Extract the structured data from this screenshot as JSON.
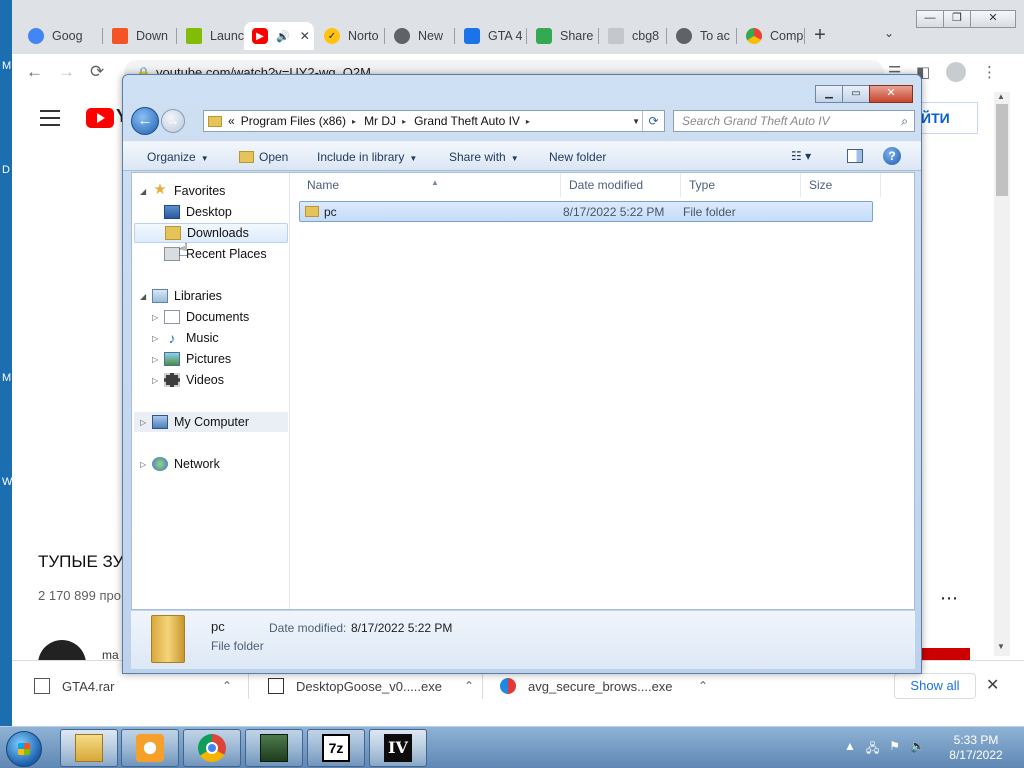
{
  "desktop_edge_letters": [
    {
      "text": "M",
      "top": 0
    },
    {
      "text": "D",
      "top": 0
    },
    {
      "text": "M",
      "top": 0
    },
    {
      "text": "W",
      "top": 0
    }
  ],
  "browser": {
    "tabs": [
      {
        "label": "Goog",
        "icon": "google-icon",
        "color": "#4285f4"
      },
      {
        "label": "Down",
        "icon": "windows-icon",
        "color": "#f35325"
      },
      {
        "label": "Launc",
        "icon": "windows-icon",
        "color": "#81bc06"
      },
      {
        "label": "",
        "icon": "youtube-icon",
        "color": "#ff0000",
        "audio": "🔊",
        "close": "✕"
      },
      {
        "label": "Norto",
        "icon": "norton-icon",
        "color": "#ffc20e"
      },
      {
        "label": "New",
        "icon": "chrome-icon",
        "color": "#5f6368"
      },
      {
        "label": "GTA 4",
        "icon": "gamepad-icon",
        "color": "#1a73e8"
      },
      {
        "label": "Share",
        "icon": "share-icon",
        "color": "#34a853"
      },
      {
        "label": "cbg8",
        "icon": "file-icon",
        "color": "#9aa0a6"
      },
      {
        "label": "To ac",
        "icon": "globe-icon",
        "color": "#5f6368"
      },
      {
        "label": "Comp",
        "icon": "compare-icon",
        "color": "#ea4335"
      }
    ],
    "new_tab": "+",
    "tab_search": "⌄",
    "window_controls": {
      "minimize": "—",
      "maximize": "❐",
      "close": "✕"
    },
    "nav": {
      "back": "←",
      "forward": "→",
      "reload": "⟳"
    },
    "url": "youtube.com/watch?v=UY2-wg_Q2M",
    "youtube": {
      "logo_text": "Y",
      "sign_in": "ЙТИ",
      "video_title": "ТУПЫЕ ЗУ",
      "views": "2 170 899 про",
      "more": "⋯",
      "channel_partial": "ma"
    },
    "downloads": [
      {
        "name": "GTA4.rar",
        "icon": "rar-icon"
      },
      {
        "name": "DesktopGoose_v0.....exe",
        "icon": "exe-icon"
      },
      {
        "name": "avg_secure_brows....exe",
        "icon": "avg-icon"
      }
    ],
    "chevron": "⌃",
    "show_all": "Show all",
    "close_bar": "✕"
  },
  "explorer": {
    "controls": {
      "minimize": "▁",
      "maximize": "▭",
      "close": "✕"
    },
    "address": {
      "overflow": "«",
      "crumbs": [
        "Program Files (x86)",
        "Mr DJ",
        "Grand Theft Auto IV"
      ],
      "separator": "▸",
      "dropdown": "▼",
      "refresh": "⟳"
    },
    "search_placeholder": "Search Grand Theft Auto IV",
    "commands": {
      "organize": "Organize",
      "open": "Open",
      "include": "Include in library",
      "share": "Share with",
      "new_folder": "New folder",
      "arrow": "▼"
    },
    "nav_pane": {
      "favorites": "Favorites",
      "desktop": "Desktop",
      "downloads": "Downloads",
      "recent": "Recent Places",
      "libraries": "Libraries",
      "documents": "Documents",
      "music": "Music",
      "pictures": "Pictures",
      "videos": "Videos",
      "computer": "My Computer",
      "network": "Network"
    },
    "columns": {
      "name": "Name",
      "date": "Date modified",
      "type": "Type",
      "size": "Size"
    },
    "files": [
      {
        "name": "pc",
        "date": "8/17/2022 5:22 PM",
        "type": "File folder",
        "size": ""
      }
    ],
    "details": {
      "name": "pc",
      "type": "File folder",
      "modified_label": "Date modified:",
      "modified_value": "8/17/2022 5:22 PM"
    }
  },
  "taskbar": {
    "clock_time": "5:33 PM",
    "clock_date": "8/17/2022",
    "sevenzip": "7z",
    "gta": "IV",
    "tray": [
      "▲",
      "🖧",
      "⚑",
      "🔈"
    ]
  }
}
